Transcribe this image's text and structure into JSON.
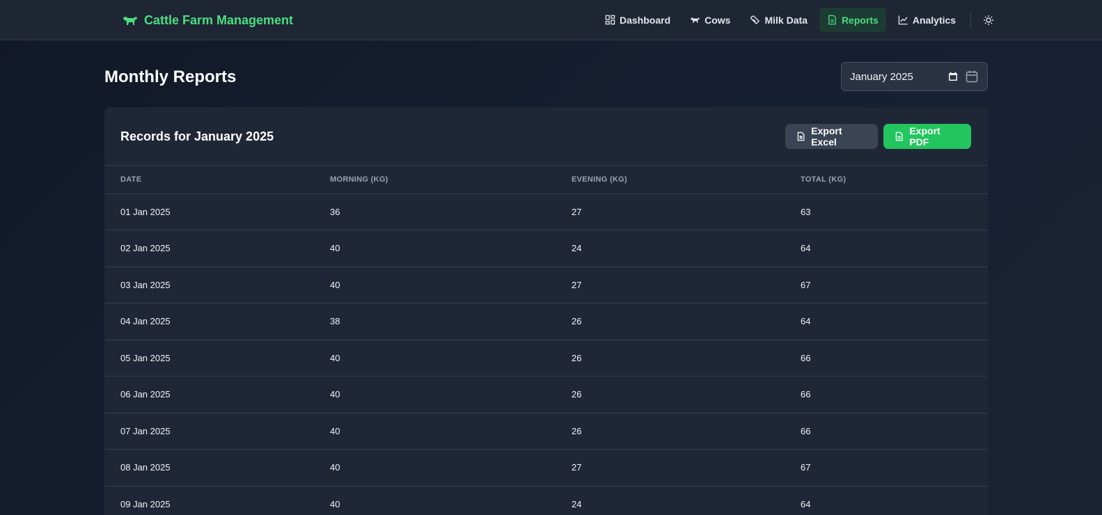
{
  "app": {
    "title": "Cattle Farm Management",
    "brand_color": "#4ade80"
  },
  "nav": {
    "items": [
      {
        "label": "Dashboard",
        "icon": "dashboard-grid-icon"
      },
      {
        "label": "Cows",
        "icon": "cow-icon"
      },
      {
        "label": "Milk Data",
        "icon": "milk-drop-icon"
      },
      {
        "label": "Reports",
        "icon": "document-icon",
        "active": true
      },
      {
        "label": "Analytics",
        "icon": "line-chart-icon"
      }
    ],
    "theme_toggle_icon": "sun-icon"
  },
  "page": {
    "title": "Monthly Reports",
    "month_value": "January 2025"
  },
  "card": {
    "title": "Records for January 2025",
    "export_excel_label": "Export Excel",
    "export_pdf_label": "Export PDF",
    "export_pdf_color": "#22c55e"
  },
  "table": {
    "columns": [
      "DATE",
      "MORNING (KG)",
      "EVENING (KG)",
      "TOTAL (KG)"
    ],
    "rows": [
      [
        "01 Jan 2025",
        "36",
        "27",
        "63"
      ],
      [
        "02 Jan 2025",
        "40",
        "24",
        "64"
      ],
      [
        "03 Jan 2025",
        "40",
        "27",
        "67"
      ],
      [
        "04 Jan 2025",
        "38",
        "26",
        "64"
      ],
      [
        "05 Jan 2025",
        "40",
        "26",
        "66"
      ],
      [
        "06 Jan 2025",
        "40",
        "26",
        "66"
      ],
      [
        "07 Jan 2025",
        "40",
        "26",
        "66"
      ],
      [
        "08 Jan 2025",
        "40",
        "27",
        "67"
      ],
      [
        "09 Jan 2025",
        "40",
        "24",
        "64"
      ]
    ]
  }
}
